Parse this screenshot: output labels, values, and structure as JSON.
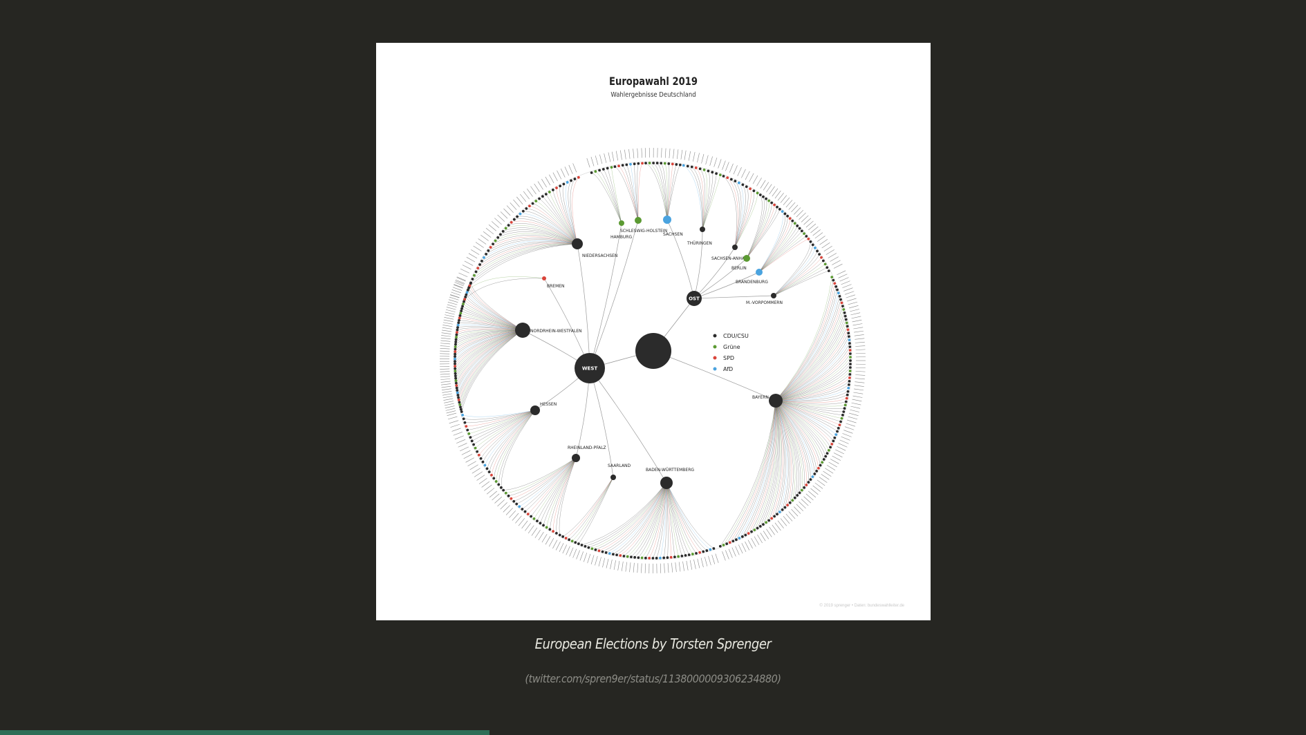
{
  "figure": {
    "title": "Europawahl 2019",
    "subtitle": "Wahlergebnisse Deutschland",
    "credit": "© 2019 sprenger • Daten: bundeswahlleiter.de",
    "colors": {
      "cdu": "#2b2b2b",
      "gruene": "#5b9a32",
      "spd": "#d9443a",
      "afd": "#4aa3df"
    },
    "hubs": [
      {
        "id": "center",
        "label": ""
      },
      {
        "id": "west",
        "label": "WEST"
      },
      {
        "id": "ost",
        "label": "OST"
      }
    ],
    "states": [
      {
        "id": "niedersachsen",
        "label": "NIEDERSACHSEN",
        "party": "cdu"
      },
      {
        "id": "hamburg",
        "label": "HAMBURG",
        "party": "gruene"
      },
      {
        "id": "schleswig-holstein",
        "label": "SCHLESWIG-HOLSTEIN",
        "party": "gruene"
      },
      {
        "id": "sachsen",
        "label": "SACHSEN",
        "party": "afd"
      },
      {
        "id": "thueringen",
        "label": "THÜRINGEN",
        "party": "cdu"
      },
      {
        "id": "sachsen-anhalt",
        "label": "SACHSEN-ANHALT",
        "party": "cdu"
      },
      {
        "id": "berlin",
        "label": "BERLIN",
        "party": "gruene"
      },
      {
        "id": "brandenburg",
        "label": "BRANDENBURG",
        "party": "afd"
      },
      {
        "id": "mv",
        "label": "M.-VORPOMMERN",
        "party": "cdu"
      },
      {
        "id": "bremen",
        "label": "BREMEN",
        "party": "spd"
      },
      {
        "id": "nrw",
        "label": "NORDRHEIN-WESTFALEN",
        "party": "cdu"
      },
      {
        "id": "bayern",
        "label": "BAYERN",
        "party": "cdu"
      },
      {
        "id": "hessen",
        "label": "HESSEN",
        "party": "cdu"
      },
      {
        "id": "rlp",
        "label": "RHEINLAND-PFALZ",
        "party": "cdu"
      },
      {
        "id": "saarland",
        "label": "SAARLAND",
        "party": "cdu"
      },
      {
        "id": "bw",
        "label": "BADEN-WÜRTTEMBERG",
        "party": "cdu"
      }
    ],
    "legend": [
      {
        "label": "CDU/CSU",
        "party": "cdu"
      },
      {
        "label": "Grüne",
        "party": "gruene"
      },
      {
        "label": "SPD",
        "party": "spd"
      },
      {
        "label": "AfD",
        "party": "afd"
      }
    ]
  },
  "caption": {
    "title": "European Elections by Torsten Sprenger",
    "link": "(twitter.com/spren9er/status/1138000009306234880)"
  },
  "progress": {
    "value": 0.375
  }
}
